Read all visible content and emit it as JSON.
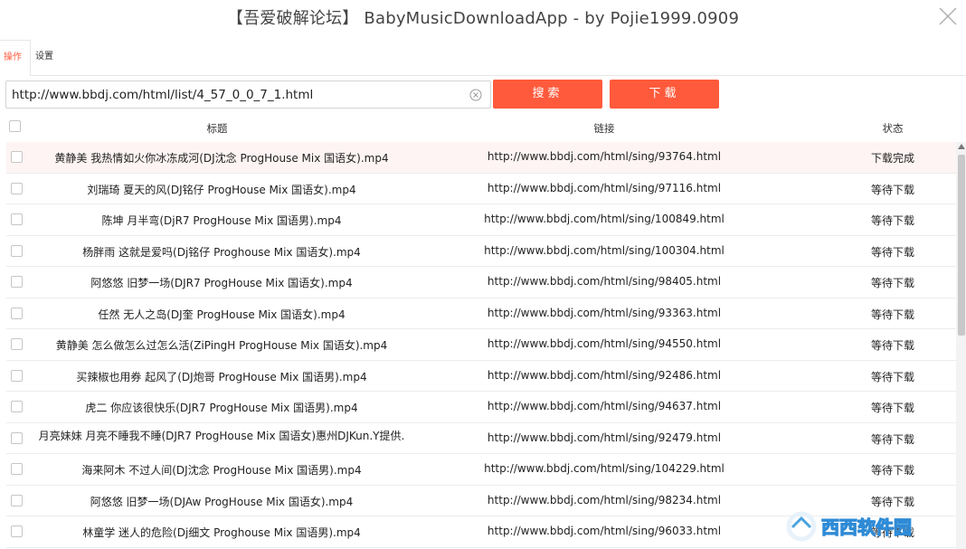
{
  "window": {
    "title": "【吾爱破解论坛】 BabyMusicDownloadApp - by Pojie1999.0909"
  },
  "tabs": [
    {
      "label": "操作",
      "active": true
    },
    {
      "label": "设置",
      "active": false
    }
  ],
  "url_input": {
    "value": "http://www.bbdj.com/html/list/4_57_0_0_7_1.html"
  },
  "buttons": {
    "search": "搜索",
    "download": "下载"
  },
  "table": {
    "headers": {
      "title": "标题",
      "link": "链接",
      "status": "状态"
    },
    "rows": [
      {
        "title": "黄静美 我热情如火你冰冻成河(DJ沈念 ProgHouse Mix 国语女).mp4",
        "link": "http://www.bbdj.com/html/sing/93764.html",
        "status": "下载完成"
      },
      {
        "title": "刘瑞琦 夏天的风(DJ铭仔 ProgHouse Mix 国语女).mp4",
        "link": "http://www.bbdj.com/html/sing/97116.html",
        "status": "等待下载"
      },
      {
        "title": "陈坤 月半弯(DjR7 ProgHouse Mix 国语男).mp4",
        "link": "http://www.bbdj.com/html/sing/100849.html",
        "status": "等待下载"
      },
      {
        "title": "杨胖雨 这就是爱吗(Dj铭仔 Proghouse Mix 国语女).mp4",
        "link": "http://www.bbdj.com/html/sing/100304.html",
        "status": "等待下载"
      },
      {
        "title": "阿悠悠 旧梦一场(DJR7 ProgHouse Mix 国语女).mp4",
        "link": "http://www.bbdj.com/html/sing/98405.html",
        "status": "等待下载"
      },
      {
        "title": "任然 无人之岛(DJ奎 ProgHouse Mix 国语女).mp4",
        "link": "http://www.bbdj.com/html/sing/93363.html",
        "status": "等待下载"
      },
      {
        "title": "黄静美 怎么做怎么过怎么活(ZiPingH ProgHouse Mix 国语女).mp4",
        "link": "http://www.bbdj.com/html/sing/94550.html",
        "status": "等待下载"
      },
      {
        "title": "买辣椒也用券 起风了(DJ炮哥 ProgHouse Mix 国语男).mp4",
        "link": "http://www.bbdj.com/html/sing/92486.html",
        "status": "等待下载"
      },
      {
        "title": "虎二 你应该很快乐(DJR7 ProgHouse Mix 国语男).mp4",
        "link": "http://www.bbdj.com/html/sing/94637.html",
        "status": "等待下载"
      },
      {
        "title": "月亮妹妹 月亮不睡我不睡(DJR7 ProgHouse Mix 国语女)惠州DJKun.Y提供.",
        "link": "http://www.bbdj.com/html/sing/92479.html",
        "status": "等待下载"
      },
      {
        "title": "海来阿木 不过人间(DJ沈念 ProgHouse Mix 国语男).mp4",
        "link": "http://www.bbdj.com/html/sing/104229.html",
        "status": "等待下载"
      },
      {
        "title": "阿悠悠 旧梦一场(DJAw ProgHouse Mix 国语女).mp4",
        "link": "http://www.bbdj.com/html/sing/98234.html",
        "status": "等待下载"
      },
      {
        "title": "林童学 迷人的危险(Dj细文 Proghouse Mix 国语男).mp4",
        "link": "http://www.bbdj.com/html/sing/96033.html",
        "status": "等待下载"
      }
    ]
  },
  "watermark": {
    "text": "西西软件园"
  },
  "colors": {
    "accent": "#ff5a3c",
    "selected_row": "#fdf4f3"
  }
}
